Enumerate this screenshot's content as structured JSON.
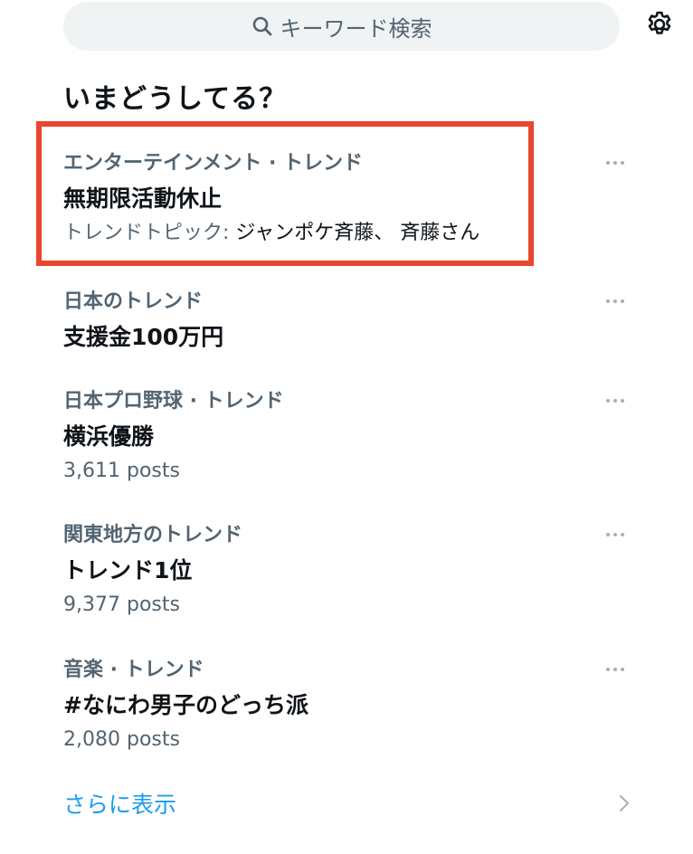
{
  "search": {
    "placeholder": "キーワード検索",
    "icon": "search-icon"
  },
  "settings": {
    "icon": "gear-icon"
  },
  "section_title": "いまどうしてる？",
  "trends": [
    {
      "category": "エンターテインメント · トレンド",
      "title": "無期限活動休止",
      "meta_prefix": "トレンドトピック: ",
      "meta_topics": "ジャンポケ斉藤、 斉藤さん",
      "highlighted": true
    },
    {
      "category": "日本のトレンド",
      "title": "支援金100万円"
    },
    {
      "category": "日本プロ野球 · トレンド",
      "title": "横浜優勝",
      "posts": "3,611 posts"
    },
    {
      "category": "関東地方のトレンド",
      "title": "トレンド1位",
      "posts": "9,377 posts"
    },
    {
      "category": "音楽 · トレンド",
      "title": "#なにわ男子のどっち派",
      "posts": "2,080 posts"
    }
  ],
  "show_more": {
    "label": "さらに表示",
    "icon": "chevron-right-icon"
  },
  "colors": {
    "accent": "#1d9bf0",
    "secondary_text": "#536471",
    "highlight_border": "#e8462f",
    "search_bg": "#eff3f4"
  }
}
